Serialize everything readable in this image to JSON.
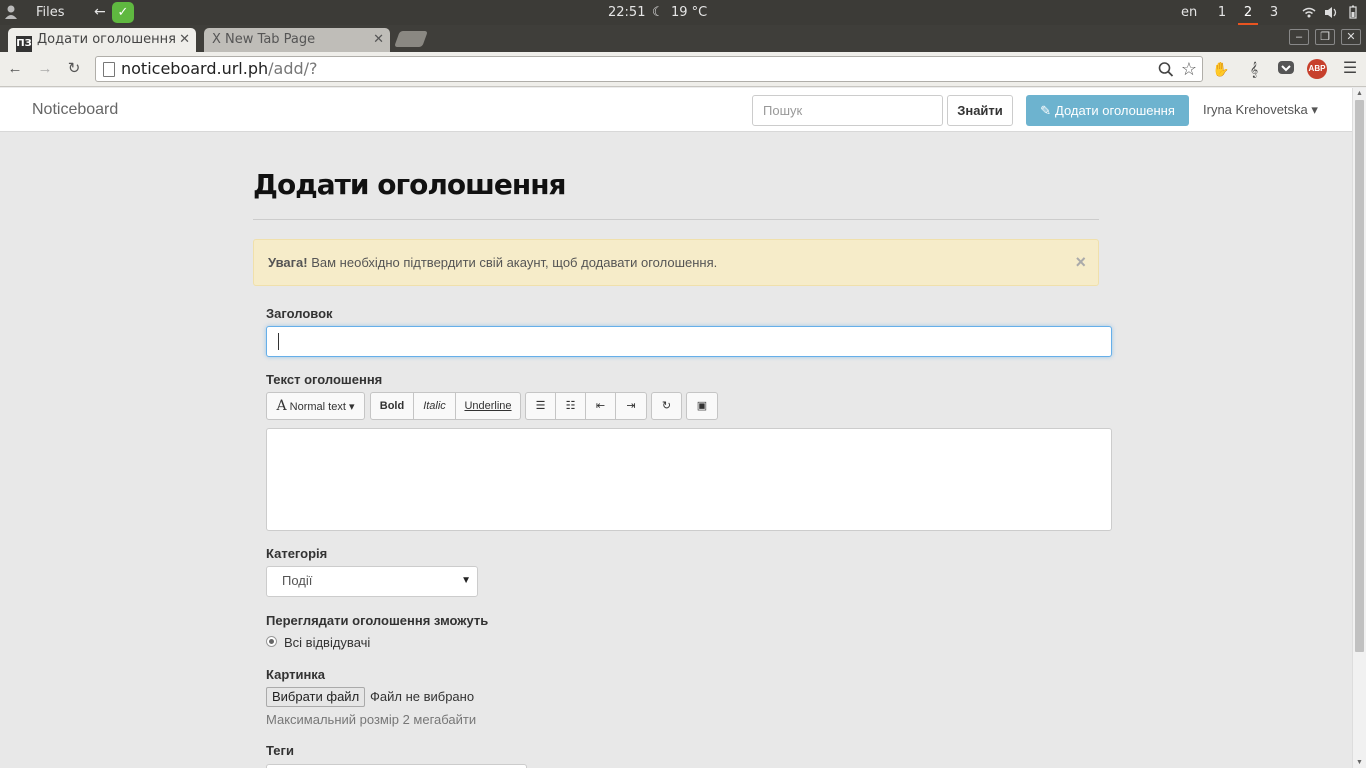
{
  "system": {
    "app_name": "Files",
    "clock": "22:51",
    "weather": "19 °C",
    "lang": "en",
    "workspaces": [
      "1",
      "2",
      "3"
    ],
    "active_workspace": "2"
  },
  "browser": {
    "tabs": [
      {
        "title": "Додати оголошення",
        "favicon": "ПЗ"
      },
      {
        "title": "X New Tab Page"
      }
    ],
    "url_host": "noticeboard.url.ph",
    "url_path": "/add/?",
    "extensions": [
      "evernote-icon",
      "music-note-icon",
      "pocket-icon",
      "adblock-icon",
      "menu-icon"
    ],
    "abp_label": "ABP"
  },
  "navbar": {
    "brand": "Noticeboard",
    "search_placeholder": "Пошук",
    "search_button": "Знайти",
    "add_button": "Додати оголошення",
    "user_name": "Iryna Krehovetska"
  },
  "form": {
    "page_title": "Додати оголошення",
    "alert_strong": "Увага!",
    "alert_text": " Вам необхідно підтвердити свій акаунт, щоб додавати оголошення.",
    "title_label": "Заголовок",
    "title_value": "",
    "text_label": "Текст оголошення",
    "editor_toolbar": {
      "font_size": "Normal text",
      "bold": "Bold",
      "italic": "Italic",
      "underline": "Underline"
    },
    "category_label": "Категорія",
    "category_value": "Події",
    "visibility_label": "Переглядати оголошення зможуть",
    "visibility_option": "Всі відвідувачі",
    "image_label": "Картинка",
    "file_button": "Вибрати файл",
    "file_status": "Файл не вибрано",
    "file_hint": "Максимальний розмір 2 мегабайти",
    "tags_label": "Теги"
  },
  "colors": {
    "accent_button": "#6db3cf",
    "alert_bg": "#f6ecc9",
    "workspace_indicator": "#e95420"
  }
}
